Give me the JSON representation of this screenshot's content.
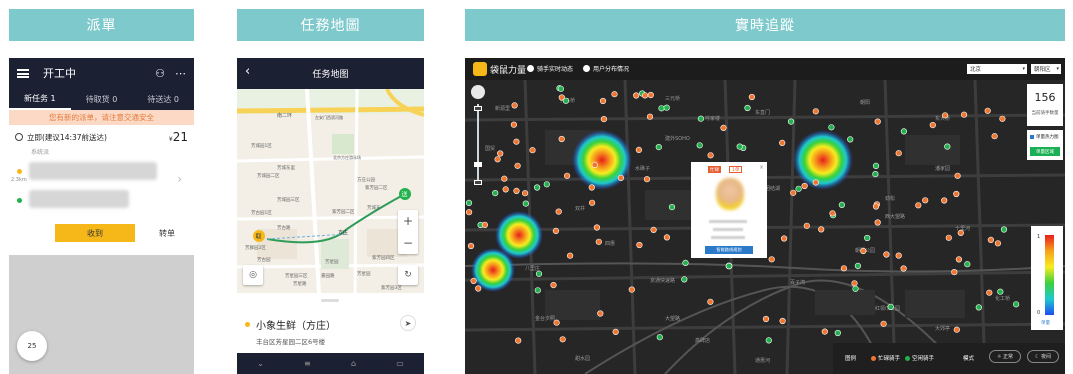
{
  "headers": {
    "dispatch": "派單",
    "task_map": "任務地圖",
    "tracking": "實時追蹤"
  },
  "dispatch": {
    "title": "开工中",
    "tabs": [
      {
        "label": "新任务 1"
      },
      {
        "label": "待取货 0"
      },
      {
        "label": "待送达 0"
      }
    ],
    "banner": "您有新的派单，请注意交通安全",
    "order": {
      "time_label": "立即(建议14:37前送达)",
      "price_currency": "¥",
      "price": "21",
      "system_label": "系统派",
      "distance": "2.3km"
    },
    "receive_button": "收到",
    "transfer_button": "转单",
    "bubble_count": "25",
    "colors": {
      "header_bg": "#1c2033",
      "accent": "#f6b819",
      "banner_bg": "#fbd9c4",
      "banner_text": "#e47b3c"
    }
  },
  "task_map": {
    "title": "任务地图",
    "map_labels": {
      "road_main": "南二环",
      "road_left": "左安门西滨河路",
      "area_1": "芳城园1区",
      "area_2": "芳城园二区",
      "area_3": "芳城园三区",
      "area_4": "芳城东里",
      "area_5": "北京方庄游泳场",
      "area_6": "方庄",
      "area_7": "芳古园1区",
      "area_8": "紫芳园3区",
      "area_9": "芳星园",
      "area_10": "芳城东",
      "area_11": "紫芳园四区",
      "area_12": "方庄公园",
      "area_13": "芳群园2区",
      "area_14": "芳古园",
      "area_15": "紫芳园二区",
      "area_16": "嘉园路",
      "area_17": "芳星园",
      "area_18": "芳星园三区",
      "area_19": "芳古路",
      "area_20": "芳星路",
      "area_21": "紫芳园二区",
      "pickup_marker": "取",
      "deliver_marker": "送"
    },
    "store_name": "小象生鲜（方庄）",
    "store_address": "丰台区芳星园二区6号楼"
  },
  "tracking": {
    "brand": "袋鼠力量",
    "radio_riders": "骑手实时动态",
    "radio_users": "用户分布情况",
    "city_select": "北京",
    "district_select": "朝阳区",
    "rider_count": "156",
    "rider_count_label": "当前骑手数量",
    "option_heatmap": "单量热力图",
    "option_button": "单量区域",
    "popup": {
      "badge_status": "忙碌",
      "badge_orders": "1单",
      "route_button": "智能路线规划"
    },
    "legend_high": "1",
    "legend_low": "0",
    "legend_unit": "单量",
    "legend_title": "图例",
    "legend_busy": "忙碌骑手",
    "legend_idle": "空闲骑手",
    "mode_label": "模式",
    "mode_normal": "正常",
    "mode_night": "夜间",
    "map_labels": {
      "l1": "新源里",
      "l2": "亮马桥",
      "l3": "三元桥",
      "l4": "东直门",
      "l5": "朝阳",
      "l6": "东大桥",
      "l7": "国贸",
      "l8": "建外SOHO",
      "l9": "京通快速路",
      "l10": "百子湾",
      "l11": "双井",
      "l12": "劲松",
      "l13": "潘家园",
      "l14": "十里河",
      "l15": "四惠",
      "l16": "朝阳公园",
      "l17": "团结湖",
      "l18": "呼家楼",
      "l19": "金台夕照",
      "l20": "大望路",
      "l21": "高碑店",
      "l22": "通惠河",
      "l23": "红领巾公园",
      "l24": "大郊亭",
      "l25": "八里庄",
      "l26": "甜水园",
      "l27": "水碓子",
      "l28": "西大望路",
      "l29": "化工桥",
      "l30": "垡头"
    },
    "colors": {
      "busy": "#f0752f",
      "idle": "#22b14c",
      "hot": "#e81d1d"
    }
  }
}
